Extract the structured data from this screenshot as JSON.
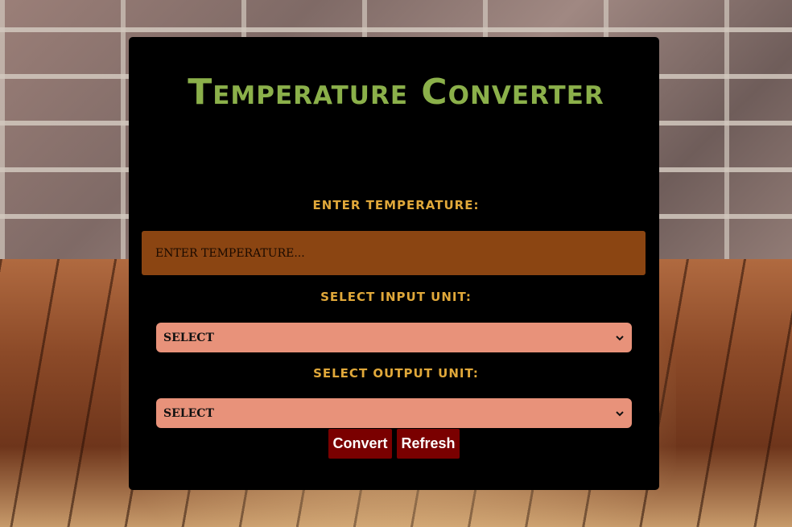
{
  "app": {
    "title": "Temperature Converter"
  },
  "form": {
    "temperature_label": "ENTER TEMPERATURE:",
    "temperature_placeholder": "ENTER TEMPERATURE...",
    "temperature_value": "",
    "input_unit_label": "SELECT INPUT UNIT:",
    "input_unit_selected": "SELECT",
    "output_unit_label": "SELECT OUTPUT UNIT:",
    "output_unit_selected": "SELECT"
  },
  "buttons": {
    "convert_label": "Convert",
    "refresh_label": "Refresh"
  },
  "icons": {
    "select_chevron": "chevron-down-icon"
  },
  "colors": {
    "card_background": "#000000",
    "title": "#8bb04a",
    "label": "#e0a83a",
    "input_background": "#8b4512",
    "select_background": "#e8927a",
    "button_background": "#7a0000",
    "button_text": "#ffffff"
  }
}
